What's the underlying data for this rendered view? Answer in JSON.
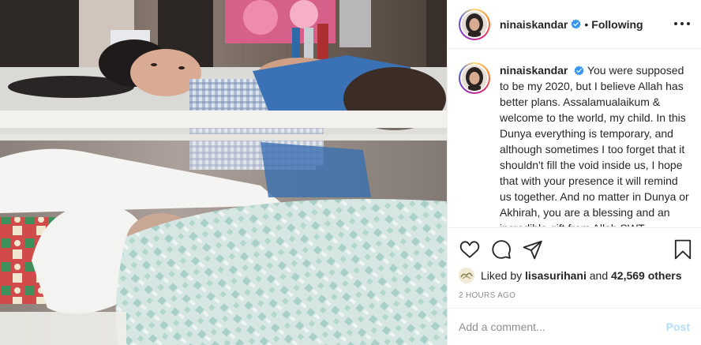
{
  "post": {
    "author": {
      "username": "ninaiskandar",
      "verified": true,
      "follow_status": "Following",
      "separator": "•"
    },
    "caption": {
      "username": "ninaiskandar",
      "text": "You were supposed to be my 2020, but I believe Allah has better plans. Assalamualaikum & welcome to the world, my child. In this Dunya everything is temporary, and although sometimes I too forget that it shouldn't fill the void inside us, I hope that with your presence it will remind us together. And no matter in Dunya or Akhirah, you are a blessing and an incredible gift from Allah SWT."
    },
    "actions": {
      "like_icon": "heart-icon",
      "comment_icon": "comment-icon",
      "share_icon": "paper-plane-icon",
      "save_icon": "bookmark-icon"
    },
    "likes": {
      "prefix": "Liked by",
      "liker": "lisasurihani",
      "conjunction": "and",
      "others": "42,569 others"
    },
    "timestamp": "2 HOURS AGO",
    "comment": {
      "placeholder": "Add a comment...",
      "post_label": "Post"
    },
    "colors": {
      "verified": "#3897f0",
      "post_disabled": "#b2dffc",
      "muted": "#8e8e8e"
    }
  }
}
